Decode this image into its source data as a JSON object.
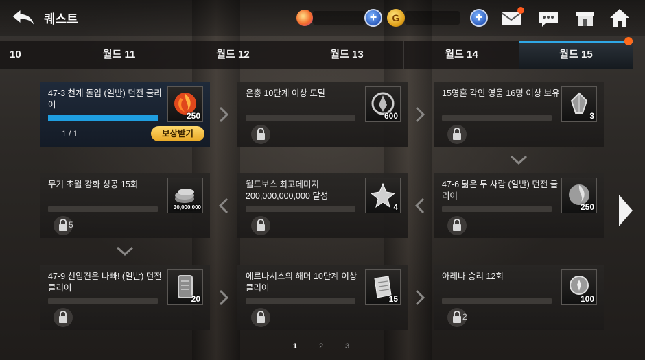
{
  "header": {
    "title": "퀘스트",
    "gold_symbol": "G"
  },
  "tabs": [
    {
      "label": "10",
      "active": false
    },
    {
      "label": "월드 11",
      "active": false
    },
    {
      "label": "월드 12",
      "active": false
    },
    {
      "label": "월드 13",
      "active": false
    },
    {
      "label": "월드 14",
      "active": false
    },
    {
      "label": "월드 15",
      "active": true
    }
  ],
  "quests": [
    {
      "title": "47-3 천계 돌입 (일반) 던전 클리어",
      "reward_qty": "250",
      "reward_icon": "fire-orb-icon",
      "status": "claimable",
      "progress_text": "1 / 1",
      "progress": 1.0,
      "claim_label": "보상받기"
    },
    {
      "title": "은총 10단계 이상 도달",
      "reward_qty": "600",
      "reward_icon": "emblem-icon",
      "status": "locked"
    },
    {
      "title": "15영혼 각인 영웅 16명 이상 보유",
      "reward_qty": "3",
      "reward_icon": "crystal-icon",
      "status": "locked"
    },
    {
      "title": "47-6 닮은 두 사람 (일반) 던전 클리어",
      "reward_qty": "250",
      "reward_icon": "silver-orb-icon",
      "status": "locked"
    },
    {
      "title": "월드보스 최고데미지 200,000,000,000 달성",
      "reward_qty": "4",
      "reward_icon": "star-emblem-icon",
      "status": "locked"
    },
    {
      "title": "무기 초월 강화 성공 15회",
      "reward_qty": "30,000,000",
      "reward_icon": "coins-icon",
      "status": "locked",
      "behind_lock": "5"
    },
    {
      "title": "47-9 선입견은 나빠! (일반) 던전 클리어",
      "reward_qty": "20",
      "reward_icon": "tablet-icon",
      "status": "locked"
    },
    {
      "title": "에르나시스의 해머 10단계 이상 클리어",
      "reward_qty": "15",
      "reward_icon": "scroll-icon",
      "status": "locked"
    },
    {
      "title": "아레나 승리 12회",
      "reward_qty": "100",
      "reward_icon": "badge-icon",
      "status": "locked",
      "behind_lock": "2"
    }
  ],
  "pagination": {
    "pages": [
      "1",
      "2",
      "3"
    ],
    "current": "1"
  }
}
